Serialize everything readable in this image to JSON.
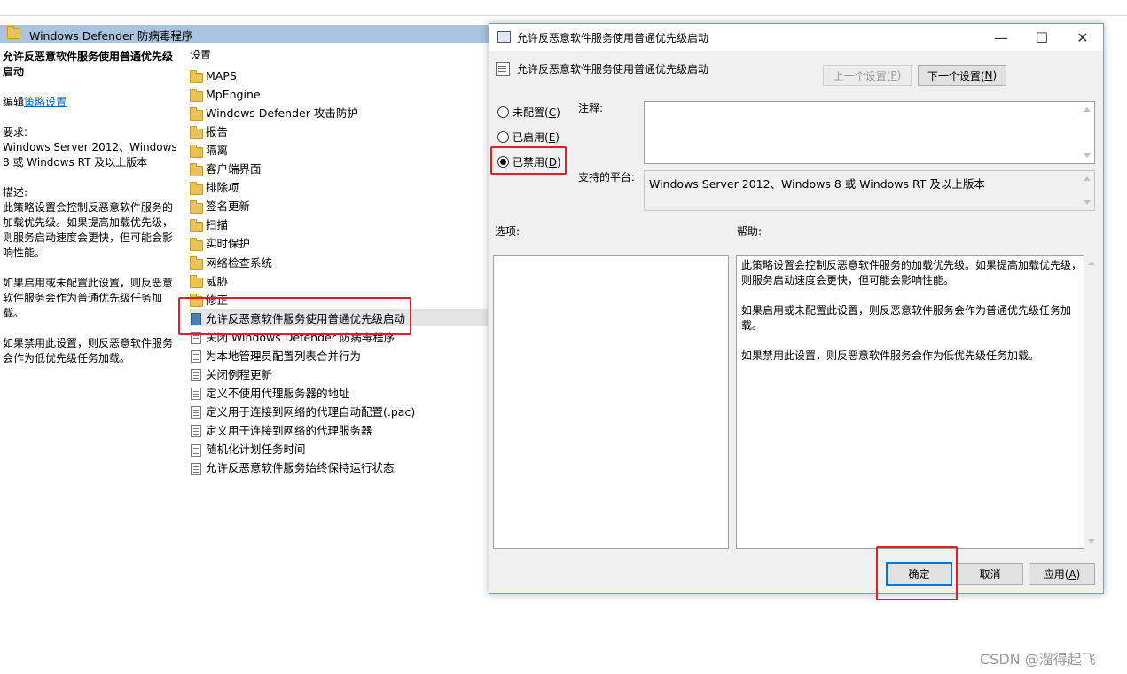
{
  "header": {
    "title": "Windows Defender 防病毒程序"
  },
  "left_pane": {
    "title": "允许反恶意软件服务使用普通优先级启动",
    "edit_prefix": "编辑",
    "edit_link": "策略设置",
    "requirements_label": "要求:",
    "requirements_text": "Windows Server 2012、Windows 8 或 Windows RT 及以上版本",
    "description_label": "描述:",
    "description_p1": "此策略设置会控制反恶意软件服务的加载优先级。如果提高加载优先级，则服务启动速度会更快，但可能会影响性能。",
    "description_p2": "如果启用或未配置此设置，则反恶意软件服务会作为普通优先级任务加载。",
    "description_p3": "如果禁用此设置，则反恶意软件服务会作为低优先级任务加载。"
  },
  "middle_pane": {
    "column_header": "设置",
    "folders": [
      "MAPS",
      "MpEngine",
      "Windows Defender 攻击防护",
      "报告",
      "隔离",
      "客户端界面",
      "排除项",
      "签名更新",
      "扫描",
      "实时保护",
      "网络检查系统",
      "威胁",
      "修正"
    ],
    "policies": [
      "允许反恶意软件服务使用普通优先级启动",
      "关闭 Windows Defender 防病毒程序",
      "为本地管理员配置列表合并行为",
      "关闭例程更新",
      "定义不使用代理服务器的地址",
      "定义用于连接到网络的代理自动配置(.pac)",
      "定义用于连接到网络的代理服务器",
      "随机化计划任务时间",
      "允许反恶意软件服务始终保持运行状态"
    ],
    "selected_index": 0
  },
  "dialog": {
    "window_title": "允许反恶意软件服务使用普通优先级启动",
    "subtitle": "允许反恶意软件服务使用普通优先级启动",
    "minimize_glyph": "—",
    "maximize_glyph": "☐",
    "close_glyph": "✕",
    "prev_setting": {
      "label": "上一个设置(",
      "key": "P",
      "suffix": ")"
    },
    "next_setting": {
      "label": "下一个设置(",
      "key": "N",
      "suffix": ")"
    },
    "radio_options": [
      {
        "label": "未配置(",
        "key": "C",
        "suffix": ")",
        "checked": false
      },
      {
        "label": "已启用(",
        "key": "E",
        "suffix": ")",
        "checked": false
      },
      {
        "label": "已禁用(",
        "key": "D",
        "suffix": ")",
        "checked": true
      }
    ],
    "comment_label": "注释:",
    "comment_value": "",
    "platform_label": "支持的平台:",
    "platform_value": "Windows Server 2012、Windows 8 或 Windows RT 及以上版本",
    "options_label": "选项:",
    "help_label": "帮助:",
    "help_p1": "此策略设置会控制反恶意软件服务的加载优先级。如果提高加载优先级，则服务启动速度会更快，但可能会影响性能。",
    "help_p2": "如果启用或未配置此设置，则反恶意软件服务会作为普通优先级任务加载。",
    "help_p3": "如果禁用此设置，则反恶意软件服务会作为低优先级任务加载。",
    "ok_label": "确定",
    "cancel_label": "取消",
    "apply": {
      "label": "应用(",
      "key": "A",
      "suffix": ")"
    }
  },
  "watermark": "CSDN @溜得起飞"
}
